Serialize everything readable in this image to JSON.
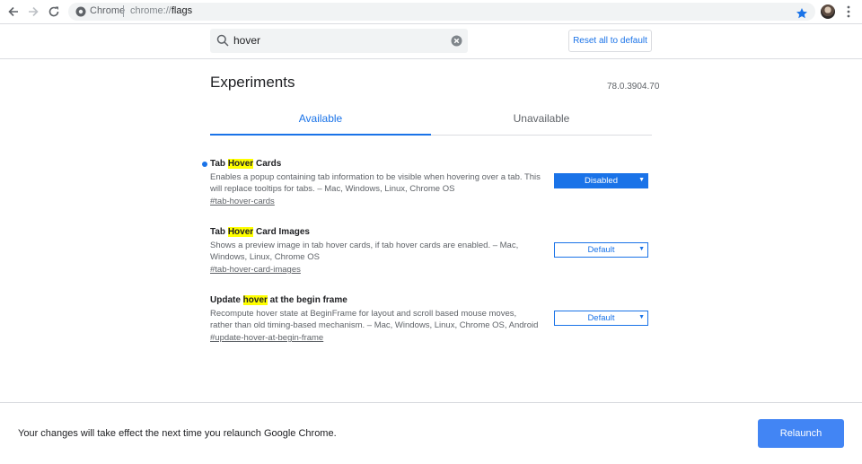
{
  "browser": {
    "site_label": "Chrome",
    "url_scheme": "chrome://",
    "url_host": "flags",
    "icons": [
      "back-icon",
      "forward-icon",
      "reload-icon",
      "site-info-icon",
      "bookmark-star-icon",
      "profile-avatar",
      "menu-icon"
    ]
  },
  "header": {
    "search_value": "hover",
    "reset_label": "Reset all to default"
  },
  "main": {
    "title": "Experiments",
    "version": "78.0.3904.70",
    "tabs": [
      {
        "label": "Available",
        "active": true
      },
      {
        "label": "Unavailable",
        "active": false
      }
    ],
    "experiments": [
      {
        "title_pre": "Tab ",
        "title_highlight": "Hover",
        "title_post": " Cards",
        "description": "Enables a popup containing tab information to be visible when hovering over a tab. This will replace tooltips for tabs. – Mac, Windows, Linux, Chrome OS",
        "link": "#tab-hover-cards",
        "selected": "Disabled",
        "modified": true
      },
      {
        "title_pre": "Tab ",
        "title_highlight": "Hover",
        "title_post": " Card Images",
        "description": "Shows a preview image in tab hover cards, if tab hover cards are enabled. – Mac, Windows, Linux, Chrome OS",
        "link": "#tab-hover-card-images",
        "selected": "Default",
        "modified": false
      },
      {
        "title_pre": "Update ",
        "title_highlight": "hover",
        "title_post": " at the begin frame",
        "description": "Recompute hover state at BeginFrame for layout and scroll based mouse moves, rather than old timing-based mechanism. – Mac, Windows, Linux, Chrome OS, Android",
        "link": "#update-hover-at-begin-frame",
        "selected": "Default",
        "modified": false
      }
    ]
  },
  "footer": {
    "message": "Your changes will take effect the next time you relaunch Google Chrome.",
    "relaunch_label": "Relaunch"
  },
  "colors": {
    "accent": "#1a73e8",
    "relaunch": "#4285f4",
    "highlight": "#ffff00"
  }
}
